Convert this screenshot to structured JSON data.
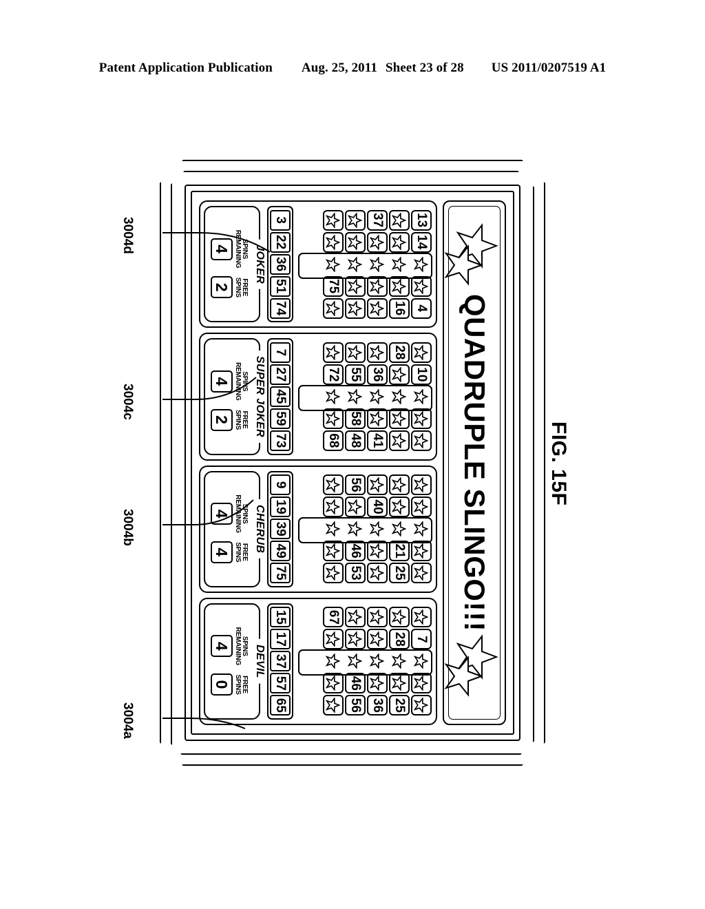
{
  "header": {
    "publication": "Patent Application Publication",
    "date": "Aug. 25, 2011",
    "sheet": "Sheet 23 of 28",
    "patent_number": "US 2011/0207519 A1"
  },
  "figure": {
    "caption": "FIG. 15F",
    "banner_title": "QUADRUPLE SLINGO!!!",
    "star_icon": "star-icon"
  },
  "reference_numerals": [
    {
      "id": "ref-3004a",
      "label": "3004a"
    },
    {
      "id": "ref-3004b",
      "label": "3004b"
    },
    {
      "id": "ref-3004c",
      "label": "3004c"
    },
    {
      "id": "ref-3004d",
      "label": "3004d"
    }
  ],
  "labels": {
    "spins_remaining": "SPINS\nREMAINING",
    "spins_remaining_l1": "SPINS",
    "spins_remaining_l2": "REMAINING",
    "free_spins_l1": "FREE",
    "free_spins_l2": "SPINS",
    "star": "☆"
  },
  "cards": [
    {
      "ref": "3004a",
      "grid": [
        [
          "13",
          "14",
          "☆",
          "☆",
          "4"
        ],
        [
          "☆",
          "☆",
          "☆",
          "☆",
          "16"
        ],
        [
          "37",
          "☆",
          "☆",
          "☆",
          "☆"
        ],
        [
          "☆",
          "☆",
          "☆",
          "☆",
          "☆"
        ],
        [
          "☆",
          "☆",
          "☆",
          "75",
          "☆"
        ]
      ],
      "reel": [
        "3",
        "22",
        "36",
        "51",
        "74"
      ],
      "bonus": {
        "name": "JOKER",
        "spins_remaining": "4",
        "free_spins": "2"
      }
    },
    {
      "ref": "3004b",
      "grid": [
        [
          "☆",
          "10",
          "☆",
          "☆",
          "☆"
        ],
        [
          "28",
          "☆",
          "☆",
          "☆",
          "☆"
        ],
        [
          "☆",
          "36",
          "☆",
          "☆",
          "41"
        ],
        [
          "☆",
          "55",
          "☆",
          "58",
          "48"
        ],
        [
          "☆",
          "72",
          "☆",
          "☆",
          "68"
        ]
      ],
      "reel": [
        "7",
        "27",
        "45",
        "59",
        "73"
      ],
      "bonus": {
        "name": "SUPER JOKER",
        "spins_remaining": "4",
        "free_spins": "2"
      }
    },
    {
      "ref": "3004c",
      "grid": [
        [
          "☆",
          "☆",
          "☆",
          "☆",
          "☆"
        ],
        [
          "☆",
          "☆",
          "☆",
          "21",
          "25"
        ],
        [
          "☆",
          "40",
          "☆",
          "☆",
          "☆"
        ],
        [
          "56",
          "☆",
          "☆",
          "46",
          "53"
        ],
        [
          "☆",
          "☆",
          "☆",
          "☆",
          "☆"
        ]
      ],
      "reel": [
        "9",
        "19",
        "39",
        "49",
        "75"
      ],
      "bonus": {
        "name": "CHERUB",
        "spins_remaining": "4",
        "free_spins": "4"
      }
    },
    {
      "ref": "3004d",
      "grid": [
        [
          "☆",
          "7",
          "☆",
          "☆",
          "☆"
        ],
        [
          "☆",
          "28",
          "☆",
          "☆",
          "25"
        ],
        [
          "☆",
          "☆",
          "☆",
          "☆",
          "36"
        ],
        [
          "☆",
          "☆",
          "☆",
          "46",
          "56"
        ],
        [
          "67",
          "☆",
          "☆",
          "☆",
          "☆"
        ]
      ],
      "reel": [
        "15",
        "17",
        "37",
        "57",
        "65"
      ],
      "bonus": {
        "name": "DEVIL",
        "spins_remaining": "4",
        "free_spins": "0"
      }
    }
  ]
}
